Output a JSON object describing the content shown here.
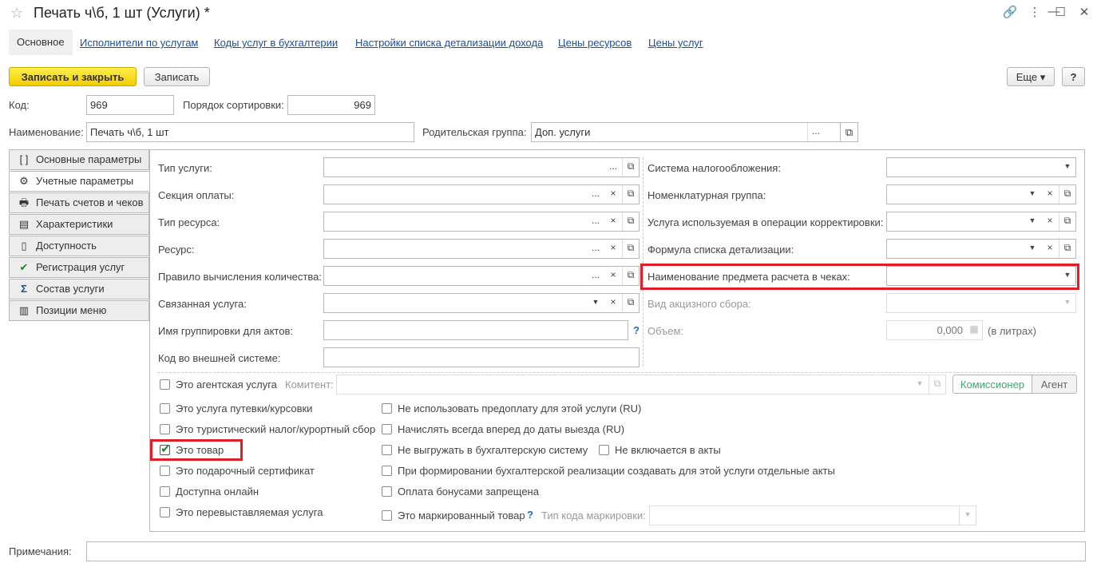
{
  "window": {
    "title": "Печать ч\\б, 1 шт (Услуги) *",
    "controls": {
      "link": "🔗",
      "menu": "⋮",
      "minimize": "—",
      "maximize": "☐",
      "close": "✕"
    }
  },
  "nav_tabs": [
    "Основное",
    "Исполнители по услугам",
    "Коды услуг в бухгалтерии",
    "Настройки списка детализации дохода",
    "Цены ресурсов",
    "Цены услуг"
  ],
  "toolbar": {
    "save_close": "Записать и закрыть",
    "save": "Записать",
    "more": "Еще ▾",
    "help": "?"
  },
  "header": {
    "code_label": "Код:",
    "code_value": "969",
    "sort_label": "Порядок сортировки:",
    "sort_value": "969",
    "name_label": "Наименование:",
    "name_value": "Печать ч\\б, 1 шт",
    "parent_label": "Родительская группа:",
    "parent_value": "Доп. услуги"
  },
  "side_tabs": [
    {
      "label": "Основные параметры",
      "icon": "[ ]"
    },
    {
      "label": "Учетные параметры",
      "icon": "⚙"
    },
    {
      "label": "Печать счетов и чеков",
      "icon": "🖶"
    },
    {
      "label": "Характеристики",
      "icon": "▤"
    },
    {
      "label": "Доступность",
      "icon": "▯"
    },
    {
      "label": "Регистрация услуг",
      "icon": "✔"
    },
    {
      "label": "Состав услуги",
      "icon": "Σ"
    },
    {
      "label": "Позиции меню",
      "icon": "▥"
    }
  ],
  "left_fields": [
    {
      "label": "Тип услуги:",
      "value": ""
    },
    {
      "label": "Секция оплаты:",
      "value": ""
    },
    {
      "label": "Тип ресурса:",
      "value": ""
    },
    {
      "label": "Ресурс:",
      "value": ""
    },
    {
      "label": "Правило вычисления количества:",
      "value": ""
    },
    {
      "label": "Связанная услуга:",
      "value": ""
    },
    {
      "label": "Имя группировки для актов:",
      "value": ""
    },
    {
      "label": "Код во внешней системе:",
      "value": ""
    }
  ],
  "right_fields": [
    {
      "label": "Система налогообложения:",
      "value": ""
    },
    {
      "label": "Номенклатурная группа:",
      "value": ""
    },
    {
      "label": "Услуга используемая в операции корректировки:",
      "value": ""
    },
    {
      "label": "Формула списка детализации:",
      "value": ""
    },
    {
      "label": "Наименование предмета расчета в чеках:",
      "value": ""
    },
    {
      "label": "Вид акцизного сбора:",
      "value": ""
    },
    {
      "label": "Объем:",
      "value": "0,000",
      "suffix": "(в литрах)"
    }
  ],
  "agent": {
    "checkbox": "Это агентская услуга",
    "committent_label": "Комитент:",
    "committent_value": "",
    "btn_commissioner": "Комиссионер",
    "btn_agent": "Агент"
  },
  "checks_left": [
    {
      "label": "Это услуга путевки/курсовки",
      "checked": false
    },
    {
      "label": "Это туристический налог/курортный сбор",
      "checked": false
    },
    {
      "label": "Это товар",
      "checked": true
    },
    {
      "label": "Это подарочный сертификат",
      "checked": false
    },
    {
      "label": "Доступна онлайн",
      "checked": false
    },
    {
      "label": "Это перевыставляемая услуга",
      "checked": false
    }
  ],
  "checks_right": [
    {
      "label": "Не использовать предоплату для этой услуги (RU)",
      "checked": false
    },
    {
      "label": "Начислять всегда вперед до даты выезда (RU)",
      "checked": false
    },
    {
      "label": "Не выгружать в бухгалтерскую систему",
      "checked": false
    },
    {
      "label": "Не включается в акты",
      "checked": false
    },
    {
      "label": "При формировании бухгалтерской реализации создавать для этой услуги отдельные акты",
      "checked": false
    },
    {
      "label": "Оплата бонусами запрещена",
      "checked": false
    },
    {
      "label": "Это маркированный товар",
      "checked": false
    }
  ],
  "marking": {
    "label": "Тип кода маркировки:",
    "value": ""
  },
  "notes": {
    "label": "Примечания:",
    "value": ""
  },
  "colors": {
    "accent_yellow": "#f7d917",
    "link": "#1a4fa0",
    "highlight_red": "#e01e2a",
    "check_green": "#1a8a2a"
  }
}
